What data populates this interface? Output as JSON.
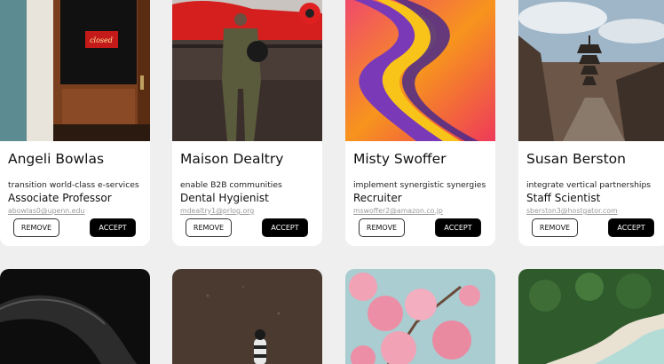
{
  "cards": [
    {
      "name": "Angeli Bowlas",
      "tagline": "transition world-class e-services",
      "role": "Associate Professor",
      "email": "abowlas0@upenn.edu",
      "photo": "red-door-closed-sign",
      "sign_text": "closed"
    },
    {
      "name": "Maison Dealtry",
      "tagline": "enable B2B communities",
      "role": "Dental Hygienist",
      "email": "mdealtry1@prlog.org",
      "photo": "pilot-helicopter"
    },
    {
      "name": "Misty Swoffer",
      "tagline": "implement synergistic synergies",
      "role": "Recruiter",
      "email": "mswoffer2@amazon.co.jp",
      "photo": "abstract-swirl"
    },
    {
      "name": "Susan Berston",
      "tagline": "integrate vertical partnerships",
      "role": "Staff Scientist",
      "email": "sberston3@hostgator.com",
      "photo": "pagoda-street"
    },
    {
      "photo": "black-curve"
    },
    {
      "photo": "cyclist-sand"
    },
    {
      "photo": "cherry-blossom"
    },
    {
      "photo": "aerial-beach"
    }
  ],
  "buttons": {
    "remove": "REMOVE",
    "accept": "ACCEPT"
  }
}
